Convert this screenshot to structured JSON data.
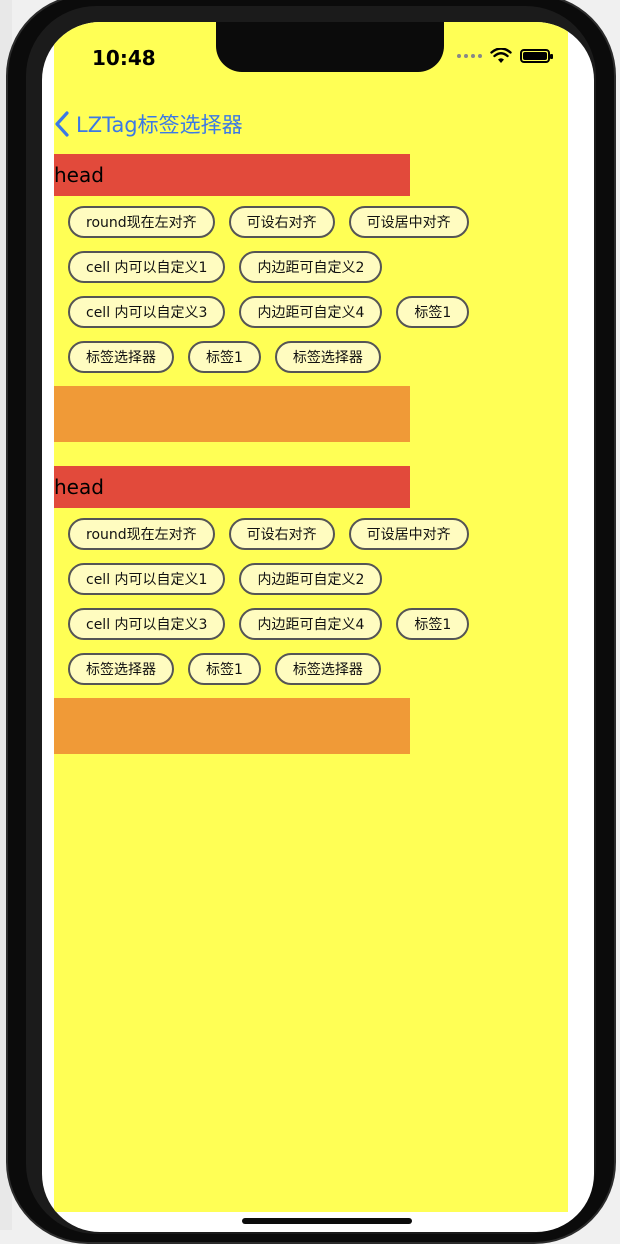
{
  "status_bar": {
    "time": "10:48"
  },
  "nav": {
    "back_label": "LZTag标签选择器"
  },
  "sections": [
    {
      "head": "head",
      "rows": [
        [
          "round现在左对齐",
          "可设右对齐",
          "可设居中对齐"
        ],
        [
          "cell 内可以自定义1",
          "内边距可自定义2"
        ],
        [
          "cell 内可以自定义3",
          "内边距可自定义4",
          "标签1"
        ],
        [
          "标签选择器",
          "标签1",
          "标签选择器"
        ]
      ]
    },
    {
      "head": "head",
      "rows": [
        [
          "round现在左对齐",
          "可设右对齐",
          "可设居中对齐"
        ],
        [
          "cell 内可以自定义1",
          "内边距可自定义2"
        ],
        [
          "cell 内可以自定义3",
          "内边距可自定义4",
          "标签1"
        ],
        [
          "标签选择器",
          "标签1",
          "标签选择器"
        ]
      ]
    }
  ],
  "colors": {
    "background": "#ffff55",
    "head": "#e24a3b",
    "footer": "#f09a37",
    "tag_fill": "#fffcc0",
    "nav_tint": "#3b79e6"
  }
}
